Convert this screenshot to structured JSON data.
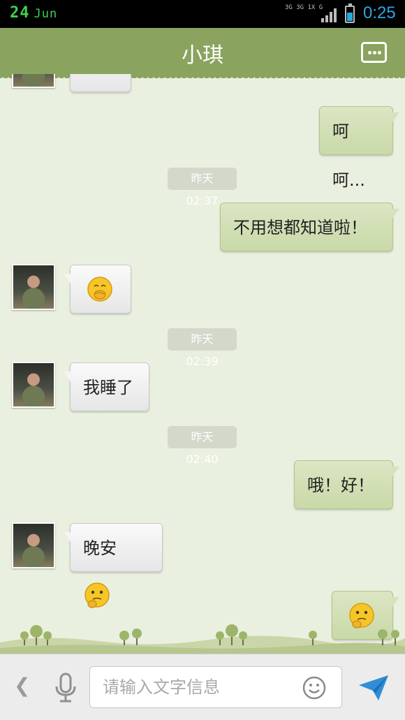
{
  "status_bar": {
    "day": "24",
    "month": "Jun",
    "network": "3G 3G 1X G",
    "time": "0:25"
  },
  "header": {
    "title": "小琪",
    "menu_icon": "more-icon"
  },
  "messages": [
    {
      "type": "text",
      "side": "out",
      "text": "呵呵..."
    },
    {
      "type": "timestamp",
      "text": "昨天 02:37"
    },
    {
      "type": "text",
      "side": "out",
      "text": "不用想都知道啦！"
    },
    {
      "type": "emoji",
      "side": "in",
      "emoji": "shy-smile-emoji"
    },
    {
      "type": "timestamp",
      "text": "昨天 02:39"
    },
    {
      "type": "text",
      "side": "in",
      "text": "我睡了"
    },
    {
      "type": "timestamp",
      "text": "昨天 02:40"
    },
    {
      "type": "text",
      "side": "out",
      "text": "哦！好！"
    },
    {
      "type": "text",
      "side": "in",
      "text": "晚安",
      "emoji": "thinking-emoji"
    },
    {
      "type": "emoji",
      "side": "out",
      "emoji": "thinking-emoji"
    }
  ],
  "input_bar": {
    "placeholder": "请输入文字信息",
    "icons": [
      "back-icon",
      "microphone-icon",
      "smiley-icon",
      "send-icon"
    ]
  },
  "colors": {
    "header": "#8aa45f",
    "background": "#e9f0df",
    "outgoing_bubble": "#cfddb1",
    "incoming_bubble": "#f2f2f2",
    "accent": "#2aa8e3"
  }
}
